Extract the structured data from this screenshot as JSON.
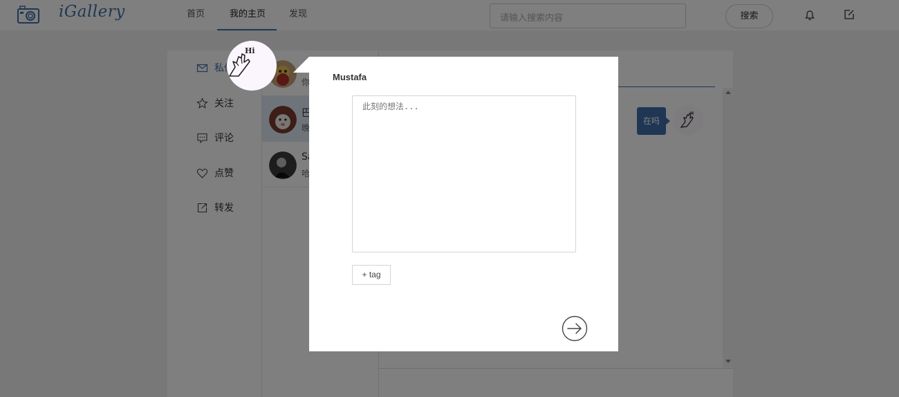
{
  "app": {
    "logo_text": "iGallery"
  },
  "nav": {
    "items": [
      {
        "label": "首页"
      },
      {
        "label": "我的主页"
      },
      {
        "label": "发现"
      }
    ],
    "active_index": 1
  },
  "search": {
    "placeholder": "请输入搜索内容",
    "button_label": "搜索"
  },
  "sidebar": {
    "items": [
      {
        "label": "私信",
        "icon": "mail-icon"
      },
      {
        "label": "关注",
        "icon": "star-icon"
      },
      {
        "label": "评论",
        "icon": "comment-icon"
      },
      {
        "label": "点赞",
        "icon": "heart-icon"
      },
      {
        "label": "转发",
        "icon": "share-icon"
      }
    ]
  },
  "conversations": [
    {
      "name": "",
      "preview": "你"
    },
    {
      "name": "巴",
      "preview": "晚"
    },
    {
      "name": "Sa",
      "preview": "哈"
    }
  ],
  "chat": {
    "bubble_text": "在吗"
  },
  "modal": {
    "title": "Mustafa",
    "textarea_placeholder": "此刻的想法...",
    "tag_button_label": "+ tag",
    "hi_label": "Hi"
  },
  "colors": {
    "accent": "#3f6ea8",
    "overlay": "rgba(0,0,0,0.5)"
  }
}
